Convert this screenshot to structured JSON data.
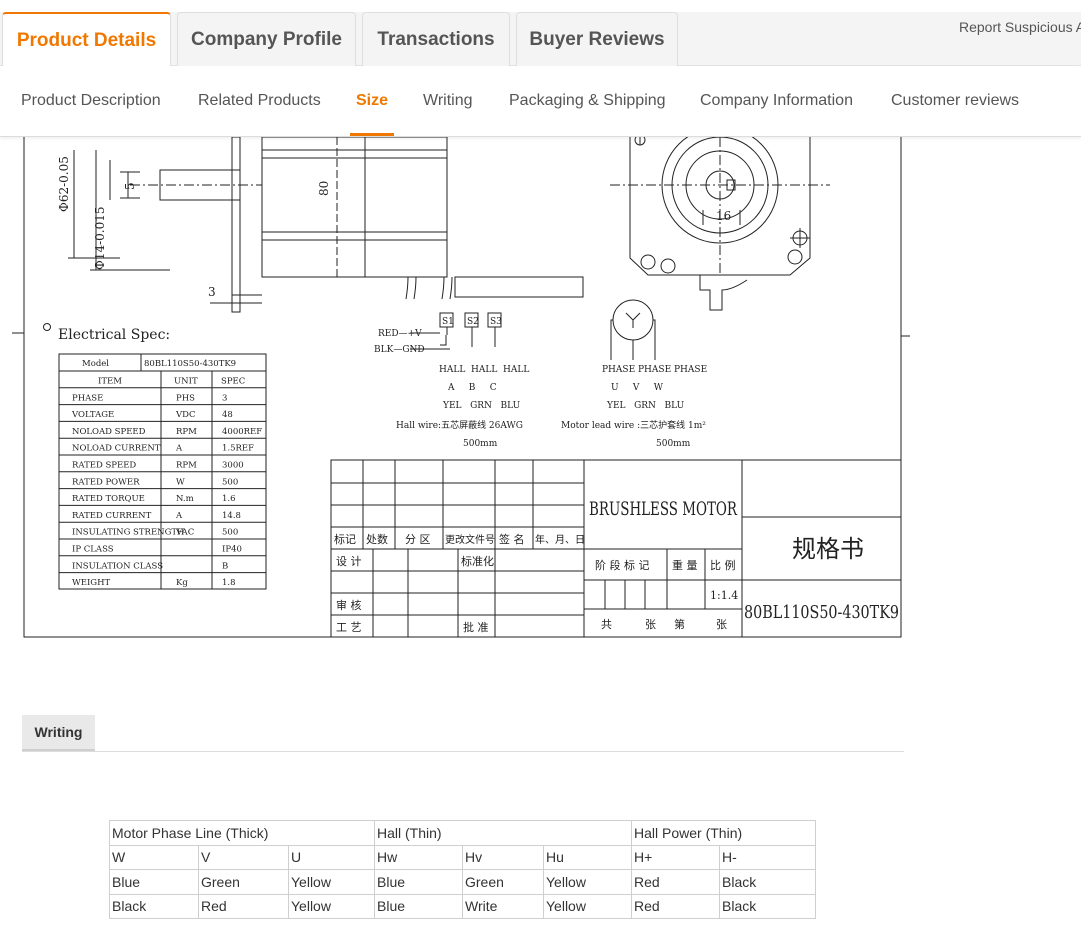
{
  "top_tabs": [
    "Product Details",
    "Company Profile",
    "Transactions",
    "Buyer Reviews"
  ],
  "report_link": "Report Suspicious Activity",
  "sub_nav": [
    "Product Description",
    "Related Products",
    "Size",
    "Writing",
    "Packaging & Shipping",
    "Company Information",
    "Customer reviews"
  ],
  "colors": {
    "accent": "#f07800"
  },
  "drawing": {
    "dim_shaft": "Φ62-0.05",
    "dim_small": "Φ14-0.015",
    "dim_5": "5",
    "dim_80": "80",
    "dim_3": "3",
    "dim_16": "16",
    "elec_title": "Electrical Spec:",
    "red": "RED—+V",
    "blk": "BLK—GND",
    "s1": "S1",
    "s2": "S2",
    "s3": "S3",
    "hall_labels": "HALL  HALL  HALL",
    "hall_abc": "A     B     C",
    "hall_colors": "YEL   GRN   BLU",
    "hall_wire": "Hall wire:五芯屏蔽线 26AWG",
    "hall_len": "500mm",
    "phase_labels": "PHASE PHASE PHASE",
    "phase_uvw": "U     V     W",
    "phase_colors": "YEL   GRN   BLU",
    "motor_wire": "Motor lead wire :三芯护套线 1m²",
    "motor_len": "500mm",
    "spec_model_label": "Model",
    "spec_model_value": "80BL110S50-430TK9",
    "spec_headers": [
      "ITEM",
      "UNIT",
      "SPEC"
    ],
    "spec_rows": [
      [
        "PHASE",
        "PHS",
        "3"
      ],
      [
        "VOLTAGE",
        "VDC",
        "48"
      ],
      [
        "NOLOAD SPEED",
        "RPM",
        "4000REF"
      ],
      [
        "NOLOAD CURRENT",
        "A",
        "1.5REF"
      ],
      [
        "RATED SPEED",
        "RPM",
        "3000"
      ],
      [
        "RATED POWER",
        "W",
        "500"
      ],
      [
        "RATED TORQUE",
        "N.m",
        "1.6"
      ],
      [
        "RATED CURRENT",
        "A",
        "14.8"
      ],
      [
        "INSULATING STRENGTH",
        "VAC",
        "500"
      ],
      [
        "IP CLASS",
        "",
        "IP40"
      ],
      [
        "INSULATION CLASS",
        "",
        "B"
      ],
      [
        "WEIGHT",
        "Kg",
        "1.8"
      ]
    ],
    "tb_marks": [
      "标记",
      "处数",
      "分 区",
      "更改文件号",
      "签 名",
      "年、月、日"
    ],
    "tb_design": "设 计",
    "tb_standard": "标准化",
    "tb_review": "审 核",
    "tb_process": "工 艺",
    "tb_approve": "批 准",
    "tb_title": "BRUSHLESS MOTOR",
    "tb_stage": "阶 段 标 记",
    "tb_weight": "重 量",
    "tb_scale": "比 例",
    "tb_scale_val": "1:1.4",
    "tb_sheets": [
      "共",
      "张",
      "第",
      "张"
    ],
    "tb_spec": "规格书",
    "tb_model": "80BL110S50-430TK9"
  },
  "writing": {
    "tab": "Writing",
    "groups": [
      "Motor Phase Line (Thick)",
      "Hall (Thin)",
      "Hall Power (Thin)"
    ],
    "rows": [
      [
        "W",
        "V",
        "U",
        "Hw",
        "Hv",
        "Hu",
        "H+",
        "H-"
      ],
      [
        "Blue",
        "Green",
        "Yellow",
        "Blue",
        "Green",
        "Yellow",
        "Red",
        "Black"
      ],
      [
        "Black",
        "Red",
        "Yellow",
        "Blue",
        "Write",
        "Yellow",
        "Red",
        "Black"
      ]
    ]
  }
}
